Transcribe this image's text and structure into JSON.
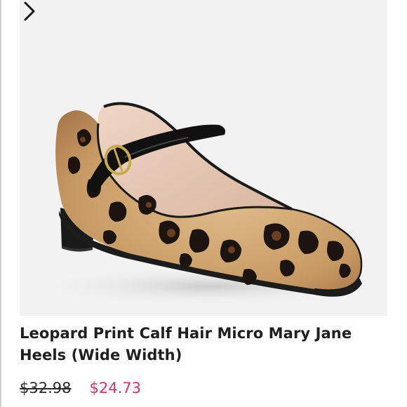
{
  "product": {
    "title": "Leopard Print Calf Hair Micro Mary Jane Heels (Wide Width)",
    "original_price": "$32.98",
    "sale_price": "$24.73",
    "image_subject": "leopard-print-mary-jane-flat"
  },
  "carousel": {
    "next_icon": "chevron-right-icon"
  },
  "colors": {
    "image_background": "#f2f2f2",
    "sale_price": "#d6336c",
    "title_text": "#1f1f1f"
  }
}
